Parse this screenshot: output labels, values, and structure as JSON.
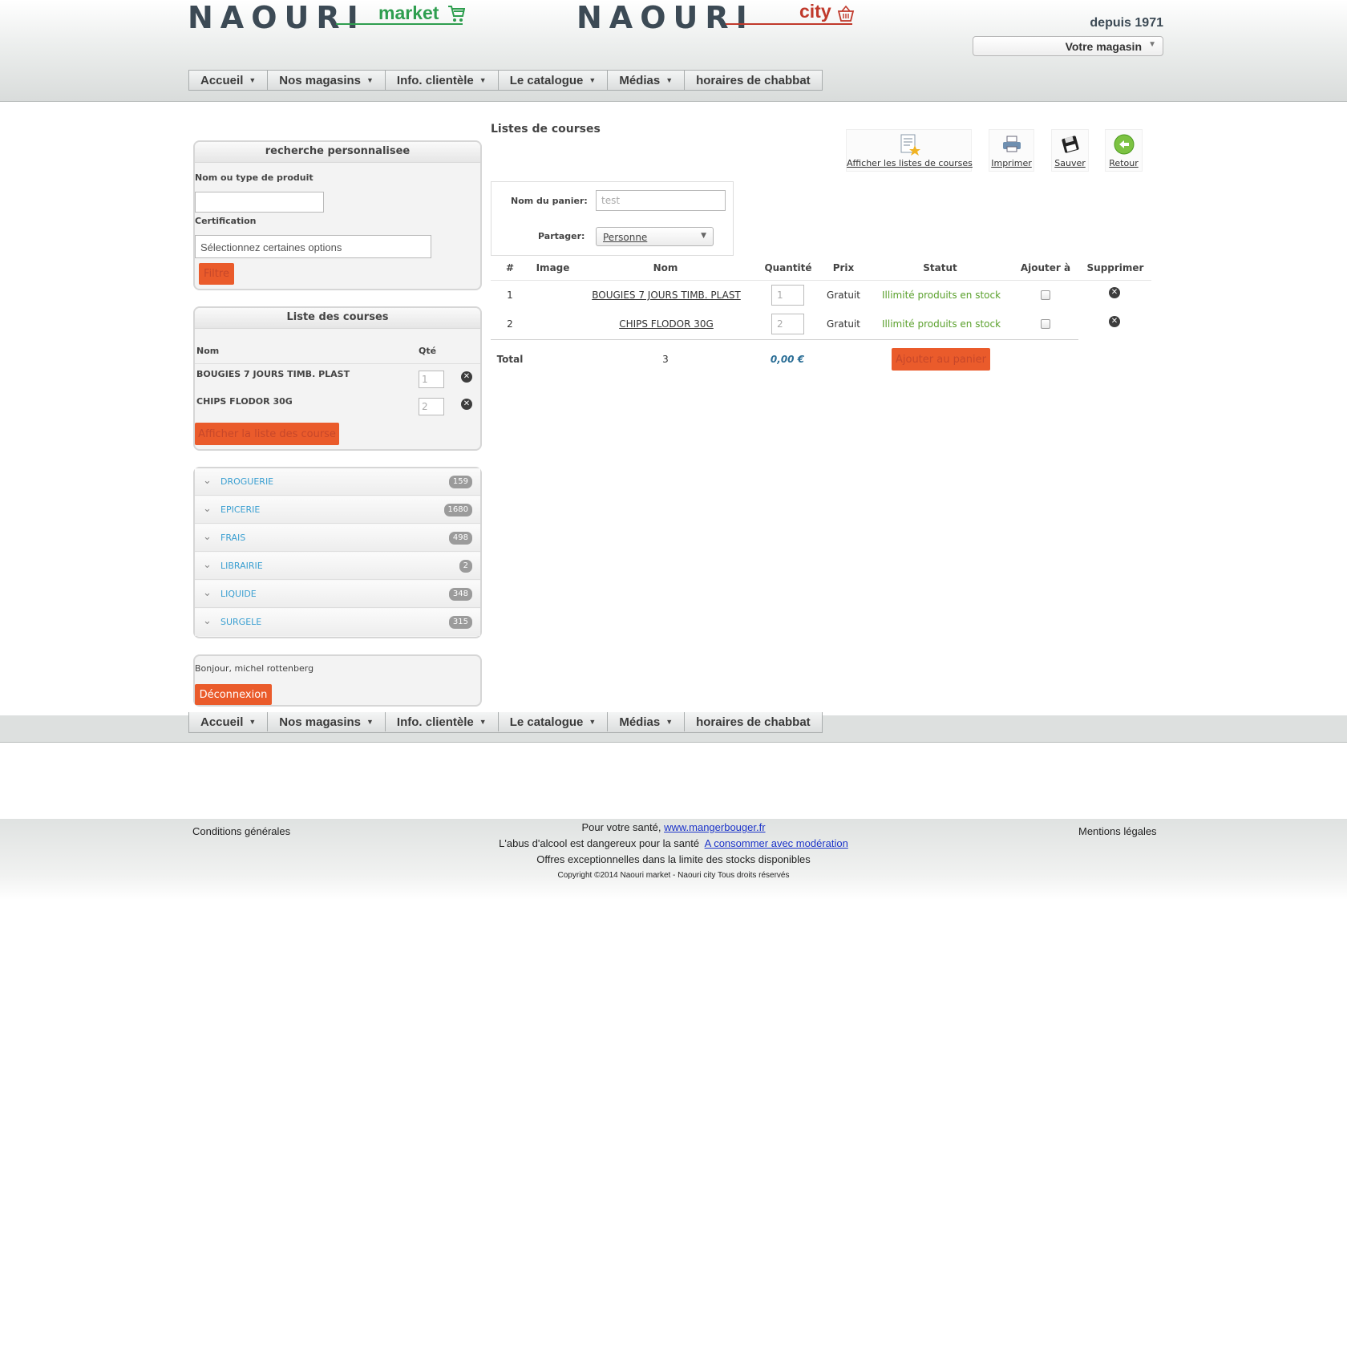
{
  "header": {
    "logo_left_word": "NAOURI",
    "logo_left_sub": "market",
    "logo_right_word": "NAOURI",
    "logo_right_sub": "city",
    "since": "depuis 1971",
    "store_select": "Votre magasin"
  },
  "nav": {
    "items": [
      "Accueil",
      "Nos magasins",
      "Info. clientèle",
      "Le catalogue",
      "Médias",
      "horaires de chabbat"
    ]
  },
  "search_panel": {
    "title": "recherche personnalisee",
    "product_label": "Nom ou type de produit",
    "product_value": "",
    "cert_label": "Certification",
    "cert_placeholder": "Sélectionnez certaines options",
    "filter_button": "Filtre"
  },
  "list_panel": {
    "title": "Liste des courses",
    "col_name": "Nom",
    "col_qty": "Qté",
    "rows": [
      {
        "name": "BOUGIES 7 JOURS TIMB. PLAST",
        "qty": "1"
      },
      {
        "name": "CHIPS FLODOR 30G",
        "qty": "2"
      }
    ],
    "show_button": "Afficher la liste des course"
  },
  "categories": [
    {
      "name": "DROGUERIE",
      "count": "159"
    },
    {
      "name": "EPICERIE",
      "count": "1680"
    },
    {
      "name": "FRAIS",
      "count": "498"
    },
    {
      "name": "LIBRAIRIE",
      "count": "2"
    },
    {
      "name": "LIQUIDE",
      "count": "348"
    },
    {
      "name": "SURGELE",
      "count": "315"
    }
  ],
  "user_panel": {
    "greeting": "Bonjour, michel rottenberg",
    "logout_button": "Déconnexion"
  },
  "main": {
    "title": "Listes de courses",
    "toolbar": {
      "show_lists": "Afficher les listes de courses",
      "print": "Imprimer",
      "save": "Sauver",
      "back": "Retour"
    },
    "basket_name_label": "Nom du panier:",
    "basket_name_placeholder": "test",
    "share_label": "Partager:",
    "share_value": "Personne",
    "table": {
      "headers": [
        "#",
        "Image",
        "Nom",
        "Quantité",
        "Prix",
        "Statut",
        "Ajouter à",
        "Supprimer"
      ],
      "rows": [
        {
          "num": "1",
          "name": "BOUGIES 7 JOURS TIMB. PLAST",
          "qty": "1",
          "price": "Gratuit",
          "status": "Illimité produits en stock"
        },
        {
          "num": "2",
          "name": "CHIPS FLODOR 30G",
          "qty": "2",
          "price": "Gratuit",
          "status": "Illimité produits en stock"
        }
      ],
      "total_label": "Total",
      "total_qty": "3",
      "total_price": "0,00 €",
      "add_to_cart_button": "Ajouter au panier"
    }
  },
  "footer": {
    "conditions": "Conditions générales",
    "health_text": "Pour votre santé,",
    "health_link": "www.mangerbouger.fr",
    "alcohol_text": "L'abus d'alcool est dangereux pour la santé",
    "alcohol_link": "A consommer avec modération",
    "offers": "Offres exceptionnelles dans la limite des stocks disponibles",
    "copyright": "Copyright ©2014   Naouri market - Naouri city Tous droits réservés",
    "legal": "Mentions légales"
  },
  "colors": {
    "accent_orange": "#ea5b2b",
    "market_green": "#2e9e4f",
    "city_red": "#c0392b",
    "link_blue": "#3a9fd1",
    "status_green": "#5aa02c"
  }
}
